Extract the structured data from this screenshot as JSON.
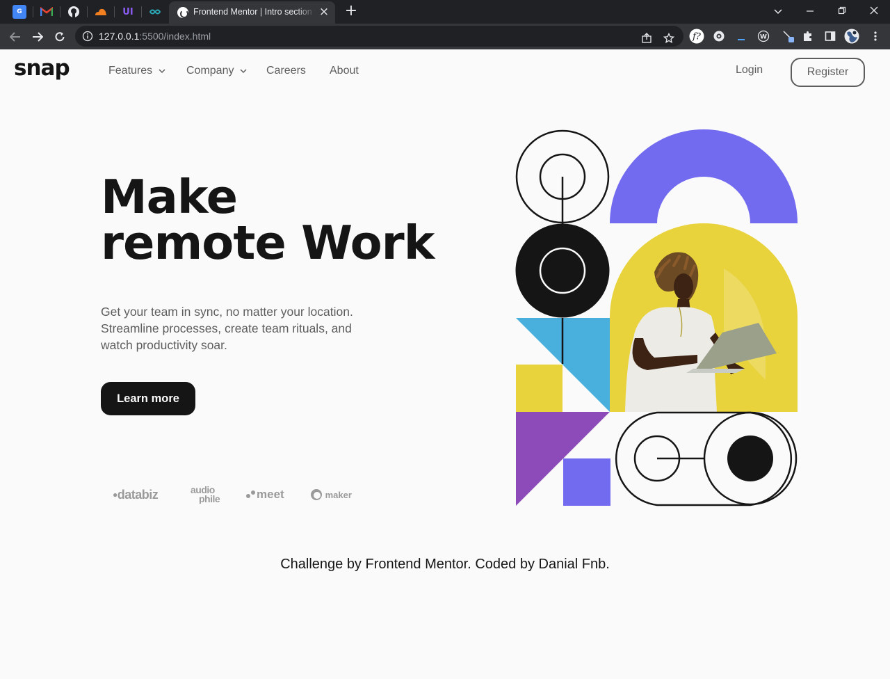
{
  "browser": {
    "tab_title": "Frontend Mentor | Intro section with dropdown navigation",
    "url_host": "127.0.0.1",
    "url_rest": ":5500/index.html",
    "pinned_tabs": [
      "google-translate-icon",
      "gmail-icon",
      "github-icon",
      "cloudflare-icon",
      "uiverse-icon",
      "codepen-icon"
    ],
    "extensions": [
      "share-icon",
      "star-icon",
      "fontninja-icon",
      "extension-icon",
      "webcache-icon",
      "picker-icon",
      "puzzle-icon",
      "sidepanel-icon",
      "profile-avatar",
      "menu-icon"
    ],
    "colors": {
      "frame": "#202124",
      "toolbar": "#35363a",
      "text": "#e8eaed"
    }
  },
  "header": {
    "logo": "snap",
    "nav": [
      {
        "label": "Features",
        "has_dropdown": true
      },
      {
        "label": "Company",
        "has_dropdown": true
      },
      {
        "label": "Careers",
        "has_dropdown": false
      },
      {
        "label": "About",
        "has_dropdown": false
      }
    ],
    "login": "Login",
    "register": "Register"
  },
  "hero": {
    "title_line1": "Make",
    "title_line2": "remote Work",
    "description": "Get your team in sync, no matter your location. Streamline processes, create team rituals, and watch productivity soar.",
    "cta": "Learn more",
    "clients": [
      "databiz",
      "audiophile",
      "meet",
      "maker"
    ],
    "image": "man-with-laptop-illustration"
  },
  "footer": {
    "credit": "Challenge by Frontend Mentor. Coded by Danial Fnb."
  },
  "colors": {
    "background": "#fafafa",
    "text_dark": "#151515",
    "text_gray": "#5d5d5d",
    "accent_purple": "#736bef",
    "accent_yellow": "#e8d33c",
    "accent_blue": "#49afdc",
    "accent_violet": "#8d4bb9"
  }
}
